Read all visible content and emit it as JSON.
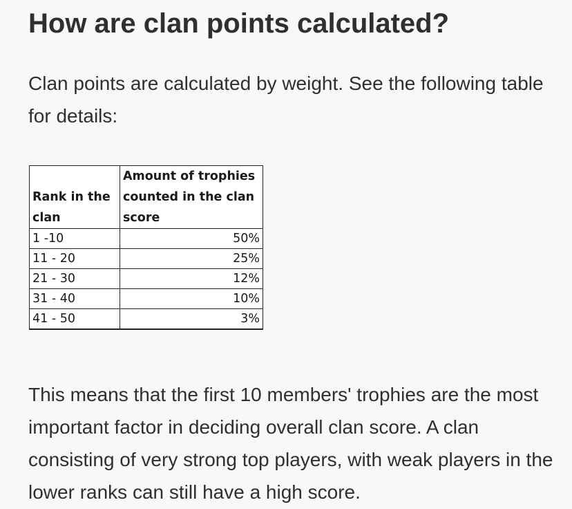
{
  "heading": "How are clan points calculated?",
  "intro": "Clan points are calculated by weight. See the following table for details:",
  "table": {
    "headers": [
      "Rank in the clan",
      "Amount of trophies counted in the clan score"
    ],
    "rows": [
      {
        "rank": "1 -10",
        "amount": "50%"
      },
      {
        "rank": "11 - 20",
        "amount": "25%"
      },
      {
        "rank": "21 - 30",
        "amount": "12%"
      },
      {
        "rank": "31 - 40",
        "amount": "10%"
      },
      {
        "rank": "41 - 50",
        "amount": "3%"
      }
    ]
  },
  "explanation": "This means that the first 10 members' trophies are the most important factor in deciding overall clan score. A clan consisting of very strong top players, with weak players in the lower ranks can still have a high score."
}
